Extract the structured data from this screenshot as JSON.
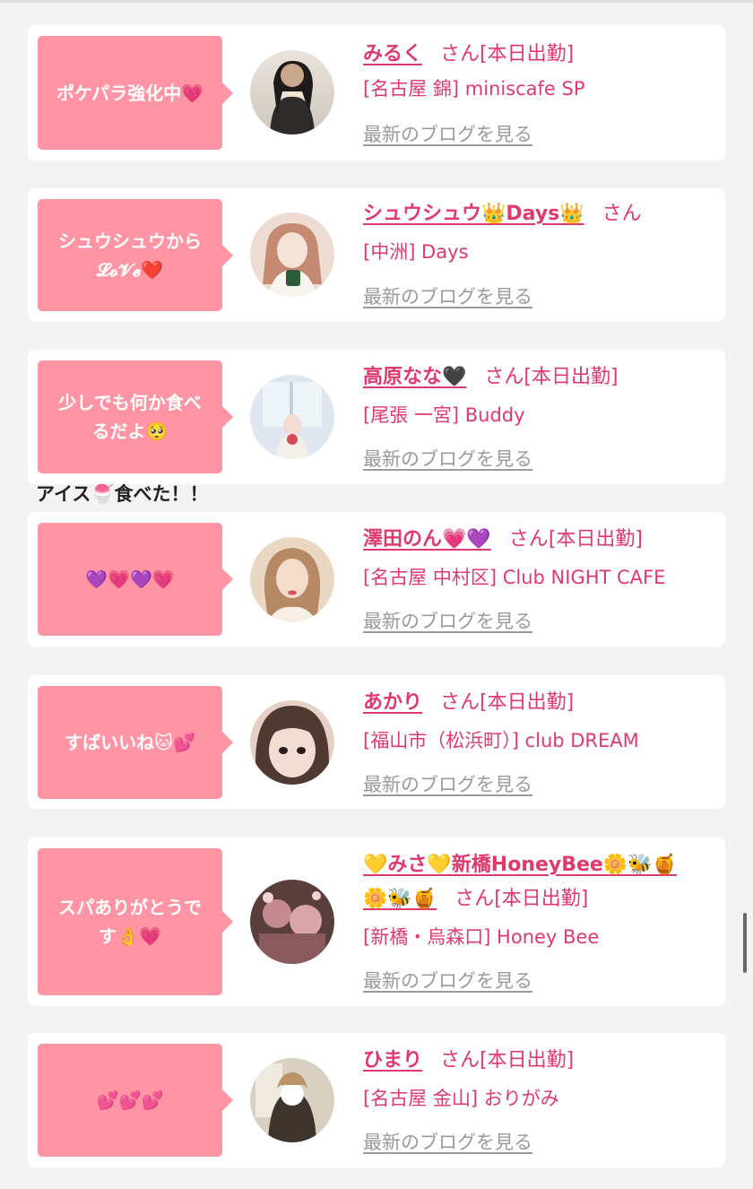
{
  "entries": [
    {
      "bubble_line1": "ポケパラ強化中💗",
      "bubble_line2": "",
      "name": "みるく",
      "name_line2": "",
      "san": "さん",
      "status": "[本日出勤]",
      "shop": "[名古屋 錦] miniscafe SP",
      "blog_label": "最新のブログを見る",
      "avatar_colors": [
        "#d9d2c8",
        "#3a3432"
      ]
    },
    {
      "bubble_line1": "シュウシュウから",
      "bubble_line2": "𝓛𝓸𝓥𝓮❤️",
      "name": "シュウシュウ👑Days👑",
      "name_line2": "",
      "san": "さん",
      "status": "",
      "shop": "[中洲] Days",
      "blog_label": "最新のブログを見る",
      "avatar_colors": [
        "#f0d6c8",
        "#c89684"
      ]
    },
    {
      "bubble_line1": "少しでも何か食べ",
      "bubble_line2": "るだよ🥺",
      "name": "高原なな🖤",
      "name_line2": "",
      "san": "さん",
      "status": "[本日出勤]",
      "shop": "[尾張 一宮] Buddy",
      "blog_label": "最新のブログを見る",
      "avatar_colors": [
        "#dde4ee",
        "#b7a7a2"
      ]
    },
    {
      "bubble_line1": "💜💗💜💗",
      "bubble_line2": "",
      "name": "澤田のん💗💜",
      "name_line2": "",
      "san": "さん",
      "status": "[本日出勤]",
      "shop": "[名古屋 中村区] Club NIGHT CAFE",
      "blog_label": "最新のブログを見る",
      "avatar_colors": [
        "#e6c9a8",
        "#9b6f4c"
      ]
    },
    {
      "bubble_line1": "すばいいね🐱💕",
      "bubble_line2": "",
      "name": "あかり",
      "name_line2": "",
      "san": "さん",
      "status": "[本日出勤]",
      "shop": "[福山市（松浜町）] club DREAM",
      "blog_label": "最新のブログを見る",
      "avatar_colors": [
        "#e8cbbf",
        "#5a4036"
      ]
    },
    {
      "bubble_line1": "スパありがとうで",
      "bubble_line2": "す👌💗",
      "name": "💛みさ💛新橋HoneyBee🌼🐝🍯",
      "name_line2": "🌼🐝🍯",
      "san": "さん",
      "status": "[本日出勤]",
      "shop": "[新橋・烏森口] Honey Bee",
      "blog_label": "最新のブログを見る",
      "avatar_colors": [
        "#c78a8e",
        "#3b2a2a"
      ]
    },
    {
      "bubble_line1": "💕💕💕",
      "bubble_line2": "",
      "name": "ひまり",
      "name_line2": "",
      "san": "さん",
      "status": "[本日出勤]",
      "shop": "[名古屋 金山] おりがみ",
      "blog_label": "最新のブログを見る",
      "avatar_colors": [
        "#cfc6b8",
        "#4a3f35"
      ]
    }
  ],
  "caption": "アイス🍧食べた！！",
  "colors": {
    "accent": "#e0396d",
    "bubble": "#ff94a4",
    "link_gray": "#9a9a9a",
    "background": "#f3f3f3"
  }
}
